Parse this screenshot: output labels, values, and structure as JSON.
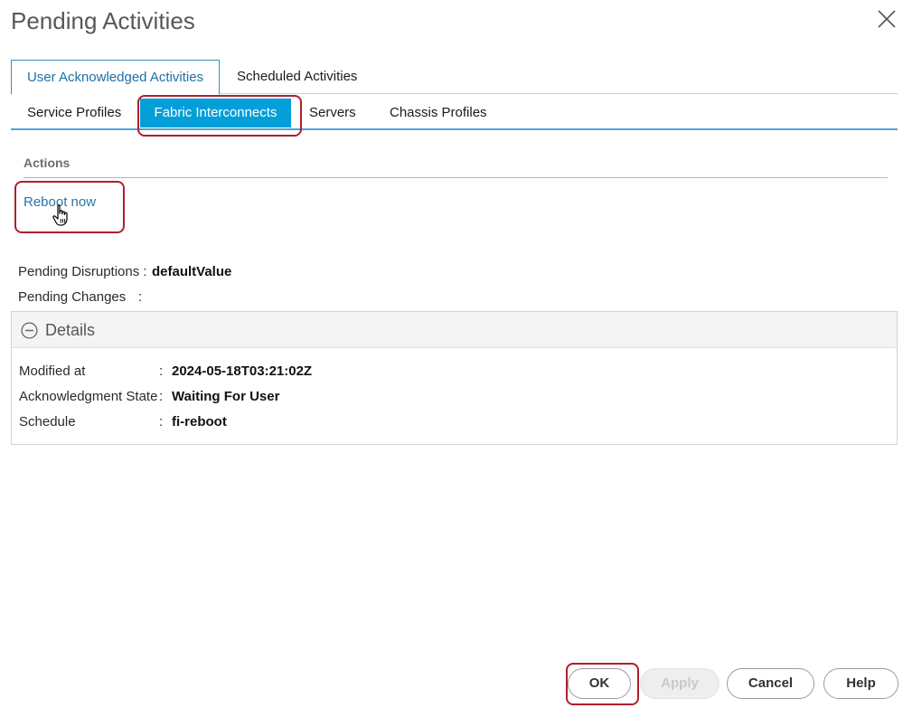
{
  "dialog": {
    "title": "Pending Activities"
  },
  "top_tabs": [
    {
      "label": "User Acknowledged Activities",
      "active": true
    },
    {
      "label": "Scheduled Activities",
      "active": false
    }
  ],
  "sub_tabs": [
    {
      "label": "Service Profiles",
      "active": false
    },
    {
      "label": "Fabric Interconnects",
      "active": true
    },
    {
      "label": "Servers",
      "active": false
    },
    {
      "label": "Chassis Profiles",
      "active": false
    }
  ],
  "actions": {
    "header": "Actions",
    "reboot_link": "Reboot now"
  },
  "pending": {
    "disruptions_label": "Pending Disruptions :",
    "disruptions_value": "defaultValue",
    "changes_label": "Pending Changes",
    "changes_sep": ":"
  },
  "details": {
    "title": "Details",
    "rows": [
      {
        "label": "Modified at",
        "sep": ":",
        "value": "2024-05-18T03:21:02Z"
      },
      {
        "label": "Acknowledgment State",
        "sep": ":",
        "value": "Waiting For User"
      },
      {
        "label": "Schedule",
        "sep": ":",
        "value": "fi-reboot"
      }
    ]
  },
  "buttons": {
    "ok": "OK",
    "apply": "Apply",
    "cancel": "Cancel",
    "help": "Help"
  },
  "colors": {
    "accent": "#049fd9",
    "highlight": "#b01f2c",
    "link": "#2d73a8"
  },
  "icons": {
    "close": "close-icon",
    "collapse": "minus-circle-icon",
    "cursor": "hand-pointer-icon"
  }
}
